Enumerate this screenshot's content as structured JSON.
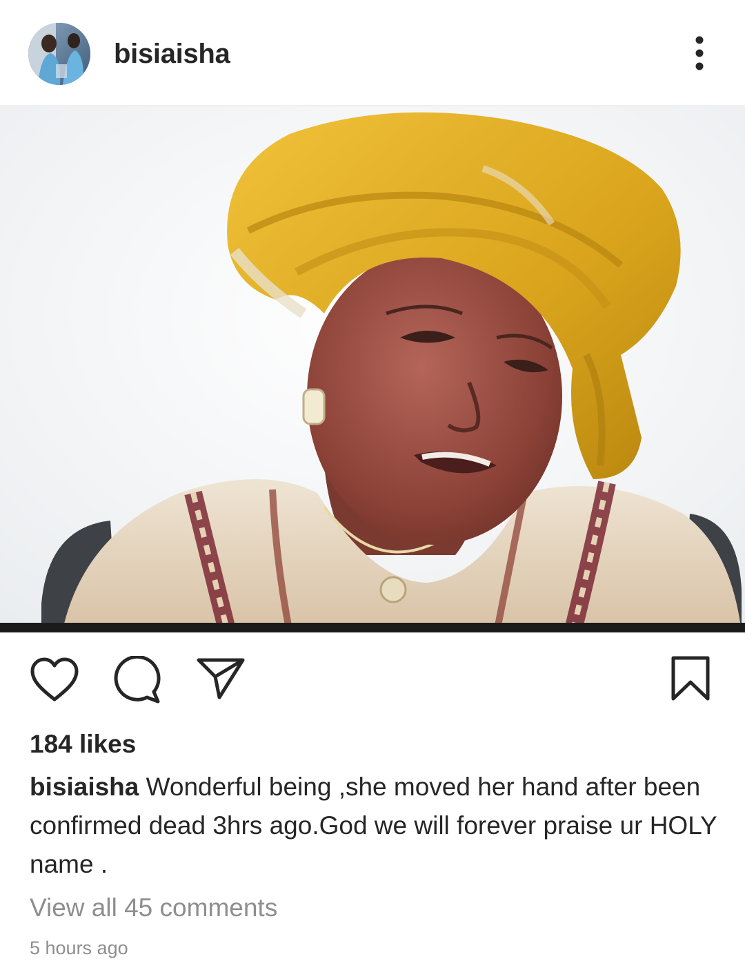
{
  "header": {
    "username": "bisiaisha",
    "more_icon": "more-vertical-icon"
  },
  "post": {
    "image_icon": "post-photo"
  },
  "actions": {
    "like_icon": "heart-icon",
    "comment_icon": "comment-icon",
    "share_icon": "send-icon",
    "save_icon": "bookmark-icon"
  },
  "likes_text": "184 likes",
  "caption": {
    "username": "bisiaisha",
    "text": " Wonderful being ,she moved her hand after been confirmed dead 3hrs ago.God we will forever praise ur HOLY name ."
  },
  "view_comments": "View all 45 comments",
  "timestamp": "5 hours ago",
  "colors": {
    "text_primary": "#262626",
    "text_secondary": "#8e8e8e",
    "divider": "#efefef",
    "headwrap": "#d9a41c"
  }
}
